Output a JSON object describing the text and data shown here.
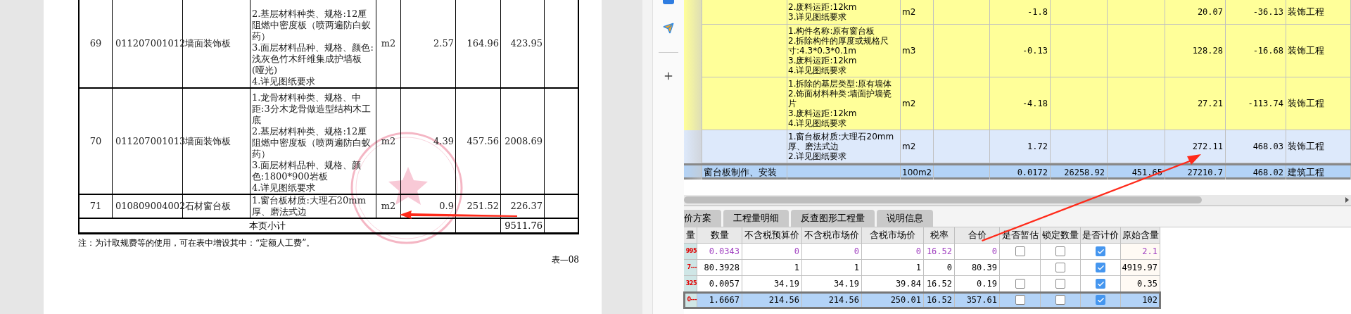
{
  "document": {
    "rows": [
      {
        "no": "69",
        "code": "011207001012",
        "name": "墙面装饰板",
        "description": [
          "2.基层材料种类、规格:12厘阻燃中密度板（喷两遍防白蚁药）",
          "3.面层材料品种、规格、颜色:浅灰色竹木纤维集成护墙板(哑光)",
          "4.详见图纸要求"
        ],
        "unit": "m2",
        "quantity": "2.57",
        "unit_price": "164.96",
        "amount": "423.95"
      },
      {
        "no": "70",
        "code": "011207001013",
        "name": "墙面装饰板",
        "description": [
          "1.龙骨材料种类、规格、中距:3分木龙骨做造型结构木工底",
          "2.基层材料种类、规格:12厘阻燃中密度板（喷两遍防白蚁药）",
          "3.面层材料品种、规格、颜色:1800*900岩板",
          "4.详见图纸要求"
        ],
        "unit": "m2",
        "quantity": "4.39",
        "unit_price": "457.56",
        "amount": "2008.69"
      },
      {
        "no": "71",
        "code": "010809004002",
        "name": "石材窗台板",
        "description": [
          "1.窗台板材质:大理石20mm厚、磨法式边"
        ],
        "unit": "m2",
        "quantity": "0.9",
        "unit_price": "251.52",
        "amount": "226.37"
      }
    ],
    "subtotal": {
      "label": "本页小计",
      "amount": "9511.76"
    },
    "note": "注：为计取规费等的使用，可在表中增设其中：“定额人工费”。",
    "form_number": "表—08"
  },
  "item_table": {
    "rows": [
      {
        "kind": "item",
        "color": "#ffff99",
        "description": [
          "2.废料运距:12km",
          "3.详见图纸要求"
        ],
        "unit": "m2",
        "column_6": "-1.8",
        "column_9": "20.07",
        "column_10": "-36.13",
        "column_11": "装饰工程"
      },
      {
        "kind": "item",
        "color": "#ffff99",
        "description": [
          "1.构件名称:原有窗台板",
          "2.拆除构件的厚度或规格尺寸:4.3*0.3*0.1m",
          "3.废料运距:12km",
          "4.详见图纸要求"
        ],
        "unit": "m3",
        "column_6": "-0.13",
        "column_9": "128.28",
        "column_10": "-16.68",
        "column_11": "装饰工程"
      },
      {
        "kind": "item",
        "color": "#ffff99",
        "description": [
          "1.拆除的基层类型:原有墙体",
          "2.饰面材料种类:墙面护墙瓷片",
          "3.废料运距:12km",
          "4.详见图纸要求"
        ],
        "unit": "m2",
        "column_6": "-4.18",
        "column_9": "27.21",
        "column_10": "-113.74",
        "column_11": "装饰工程"
      },
      {
        "kind": "item",
        "color": "#dde9fb",
        "description": [
          "1.窗台板材质:大理石20mm厚、磨法式边",
          "2.详见图纸要求"
        ],
        "unit": "m2",
        "column_6": "1.72",
        "column_9": "272.11",
        "column_10": "468.03",
        "column_11": "装饰工程"
      },
      {
        "kind": "quota",
        "color": "#b3d3f7",
        "name": "窗台板制作、安装",
        "unit": "100m2",
        "column_6": "0.0172",
        "column_7": "26258.92",
        "column_8": "451.65",
        "column_9": "27210.7",
        "column_10": "468.02",
        "column_11": "建筑工程"
      }
    ]
  },
  "tabs": [
    {
      "label": "价方案",
      "selected": false
    },
    {
      "label": "工程量明细",
      "selected": false
    },
    {
      "label": "反查图形工程量",
      "selected": false
    },
    {
      "label": "说明信息",
      "selected": false
    }
  ],
  "resource_table": {
    "columns": [
      "量",
      "数量",
      "不含税预算价",
      "不含税市场价",
      "含税市场价",
      "税率",
      "合价",
      "是否暂估",
      "锁定数量",
      "是否计价",
      "原始含量"
    ],
    "rows": [
      {
        "code": "995",
        "color": "#a040c0",
        "selected": false,
        "values": [
          "0.0343",
          "0",
          "0",
          "0",
          "16.52",
          "0"
        ],
        "provisional": false,
        "lock_quantity": false,
        "priced": true,
        "original_content": "2.1"
      },
      {
        "code": "7---",
        "color": "#000000",
        "selected": false,
        "values": [
          "80.3928",
          "1",
          "1",
          "1",
          "0",
          "80.39"
        ],
        "lock_quantity": false,
        "priced": true,
        "original_content": "4919.97"
      },
      {
        "code": "325",
        "color": "#000000",
        "selected": false,
        "values": [
          "0.0057",
          "34.19",
          "34.19",
          "39.84",
          "16.52",
          "0.19"
        ],
        "provisional": false,
        "lock_quantity": false,
        "priced": true,
        "original_content": "0.35"
      },
      {
        "code": "0---",
        "color": "#000000",
        "selected": true,
        "values": [
          "1.6667",
          "214.56",
          "214.56",
          "250.01",
          "16.52",
          "357.61"
        ],
        "provisional": false,
        "lock_quantity": false,
        "priced": true,
        "original_content": "102"
      }
    ]
  }
}
